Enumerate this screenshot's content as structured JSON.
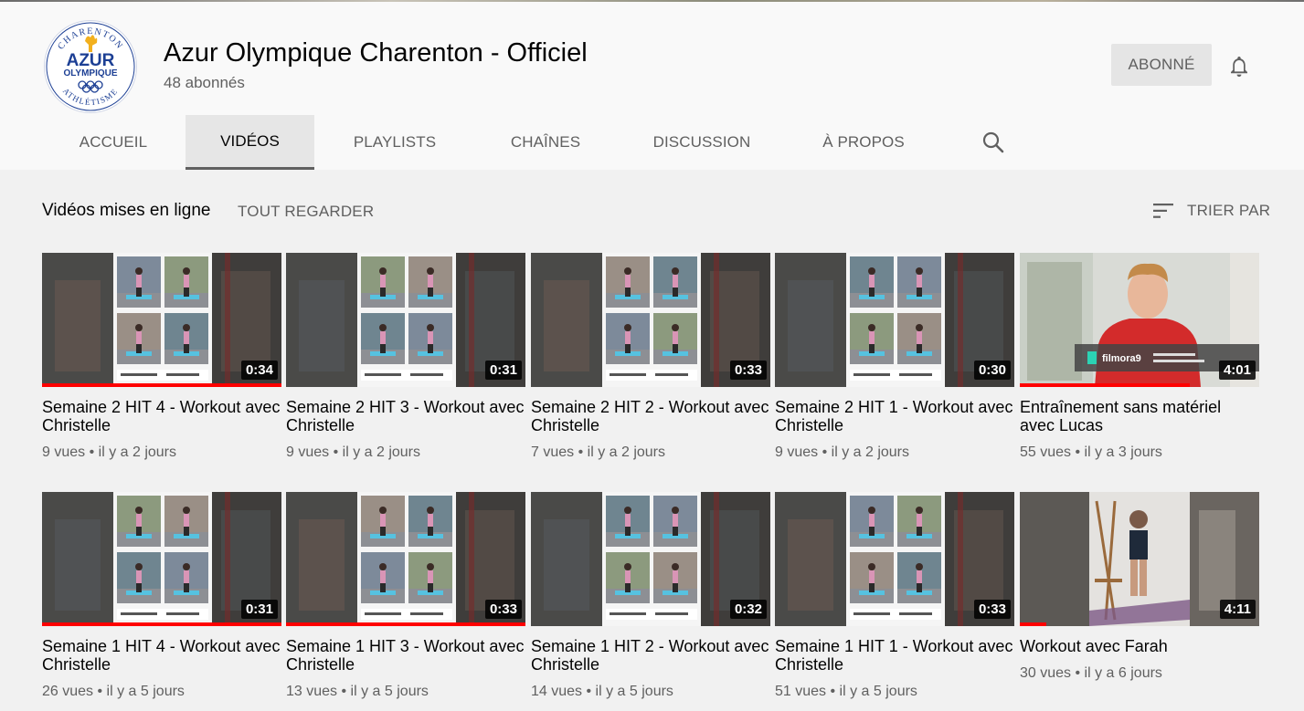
{
  "channel": {
    "name": "Azur Olympique Charenton - Officiel",
    "subscribers": "48 abonnés",
    "subscribe_label": "ABONNÉ",
    "logo": {
      "top_text": "CHARENTON",
      "main_text": "AZUR",
      "sub_text": "OLYMPIQUE",
      "bottom_text": "ATHLÉTISME"
    }
  },
  "tabs": [
    {
      "label": "ACCUEIL",
      "active": false
    },
    {
      "label": "VIDÉOS",
      "active": true
    },
    {
      "label": "PLAYLISTS",
      "active": false
    },
    {
      "label": "CHAÎNES",
      "active": false
    },
    {
      "label": "DISCUSSION",
      "active": false
    },
    {
      "label": "À PROPOS",
      "active": false
    }
  ],
  "section": {
    "title": "Vidéos mises en ligne",
    "watch_all": "TOUT REGARDER",
    "sort_label": "TRIER PAR"
  },
  "videos": [
    {
      "title": "Semaine 2 HIT 4 - Workout avec Christelle",
      "duration": "0:34",
      "views": "9 vues",
      "age": "il y a 2 jours",
      "watched": 1.0,
      "thumb": "collage"
    },
    {
      "title": "Semaine 2 HIT 3 - Workout avec Christelle",
      "duration": "0:31",
      "views": "9 vues",
      "age": "il y a 2 jours",
      "watched": 0,
      "thumb": "collage"
    },
    {
      "title": "Semaine 2 HIT 2 - Workout avec Christelle",
      "duration": "0:33",
      "views": "7 vues",
      "age": "il y a 2 jours",
      "watched": 0,
      "thumb": "collage"
    },
    {
      "title": "Semaine 2 HIT 1 - Workout avec Christelle",
      "duration": "0:30",
      "views": "9 vues",
      "age": "il y a 2 jours",
      "watched": 0,
      "thumb": "collage"
    },
    {
      "title": "Entraînement sans matériel avec Lucas",
      "duration": "4:01",
      "views": "55 vues",
      "age": "il y a 3 jours",
      "watched": 0.71,
      "thumb": "person-red"
    },
    {
      "title": "Semaine 1 HIT 4 - Workout avec Christelle",
      "duration": "0:31",
      "views": "26 vues",
      "age": "il y a 5 jours",
      "watched": 1.0,
      "thumb": "collage"
    },
    {
      "title": "Semaine 1 HIT 3 - Workout avec Christelle",
      "duration": "0:33",
      "views": "13 vues",
      "age": "il y a 5 jours",
      "watched": 1.0,
      "thumb": "collage"
    },
    {
      "title": "Semaine 1 HIT 2 - Workout avec Christelle",
      "duration": "0:32",
      "views": "14 vues",
      "age": "il y a 5 jours",
      "watched": 0,
      "thumb": "collage"
    },
    {
      "title": "Semaine 1 HIT 1 - Workout avec Christelle",
      "duration": "0:33",
      "views": "51 vues",
      "age": "il y a 5 jours",
      "watched": 0,
      "thumb": "collage"
    },
    {
      "title": "Workout avec Farah",
      "duration": "4:11",
      "views": "30 vues",
      "age": "il y a 6 jours",
      "watched": 0.11,
      "thumb": "person-room"
    }
  ],
  "colors": {
    "progress": "#ff0000",
    "accent": "#606060"
  },
  "icons": {
    "notifications": "bell-icon",
    "search": "search-icon",
    "sort": "sort-lines-icon"
  }
}
